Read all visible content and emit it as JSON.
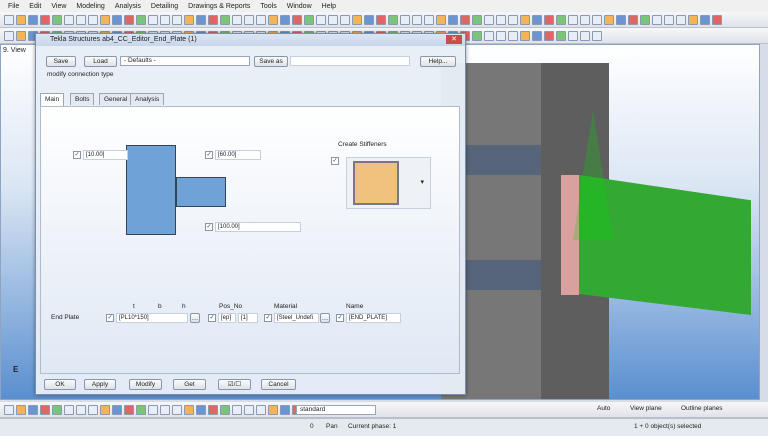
{
  "menu": [
    "File",
    "Edit",
    "View",
    "Modeling",
    "Analysis",
    "Detailing",
    "Drawings & Reports",
    "Tools",
    "Window",
    "Help"
  ],
  "view": {
    "title": "9. View",
    "axis_label": "E"
  },
  "dialog": {
    "title": "Tekla Structures  ab4_CC_Editor_End_Plate (1)",
    "save": "Save",
    "load": "Load",
    "preset": "- Defaults -",
    "save_as": "Save as",
    "help": "Help...",
    "connection_type": "modify connection type",
    "tabs": [
      "Main",
      "Bolts",
      "General",
      "Analysis"
    ],
    "dims": {
      "top_left": "[10.00]",
      "top_right": "[60.00]",
      "bottom": "[100.00]"
    },
    "create_stiffeners": "Create Stiffeners",
    "headers": {
      "t": "t",
      "b": "b",
      "h": "h",
      "pos_no": "Pos_No",
      "material": "Material",
      "name": "Name"
    },
    "end_plate": {
      "label": "End Plate",
      "profile": "[PL10*150]",
      "pos_prefix": "[ep]",
      "pos_start": "[1]",
      "material": "[Steel_Undefi",
      "name": "[END_PLATE]"
    },
    "buttons": {
      "ok": "OK",
      "apply": "Apply",
      "modify": "Modify",
      "get": "Get",
      "toggle": "☑/☐",
      "cancel": "Cancel"
    }
  },
  "bottom_toolbar": {
    "view_style": "standard",
    "auto": "Auto",
    "view_plane": "View plane",
    "outline": "Outline planes"
  },
  "status": {
    "count": "0",
    "mode": "Pan",
    "phase": "Current phase: 1",
    "selected": "1 + 0 object(s) selected"
  }
}
